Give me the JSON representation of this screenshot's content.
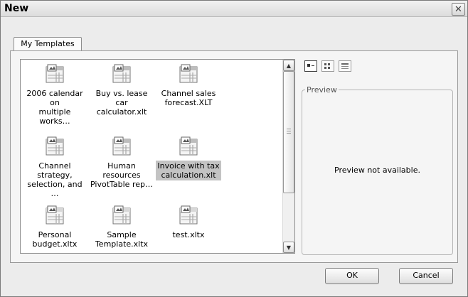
{
  "dialog": {
    "title": "New",
    "close_glyph": "✕",
    "tab": "My Templates",
    "preview_legend": "Preview",
    "preview_message": "Preview not available.",
    "ok_label": "OK",
    "cancel_label": "Cancel"
  },
  "templates": [
    {
      "label": "2006 calendar on\nmultiple works…",
      "icon": "xlt-template-icon"
    },
    {
      "label": "Buy vs. lease car\ncalculator.xlt",
      "icon": "xlt-template-icon"
    },
    {
      "label": "Channel sales\nforecast.XLT",
      "icon": "xlt-template-icon"
    },
    {
      "label": "Channel strategy,\nselection, and …",
      "icon": "xlt-template-icon"
    },
    {
      "label": "Human resources\nPivotTable rep…",
      "icon": "xlt-template-icon"
    },
    {
      "label": "Invoice with tax\ncalculation.xlt",
      "icon": "xlt-template-icon",
      "selected": true
    },
    {
      "label": "Personal\nbudget.xltx",
      "icon": "xltx-template-icon"
    },
    {
      "label": "Sample\nTemplate.xltx",
      "icon": "xltx-template-icon"
    },
    {
      "label": "test.xltx",
      "icon": "xltx-template-icon"
    }
  ],
  "view_buttons": [
    "large-icons-view-icon",
    "list-view-icon",
    "details-view-icon"
  ],
  "scroll": {
    "up": "▲",
    "down": "▼"
  }
}
